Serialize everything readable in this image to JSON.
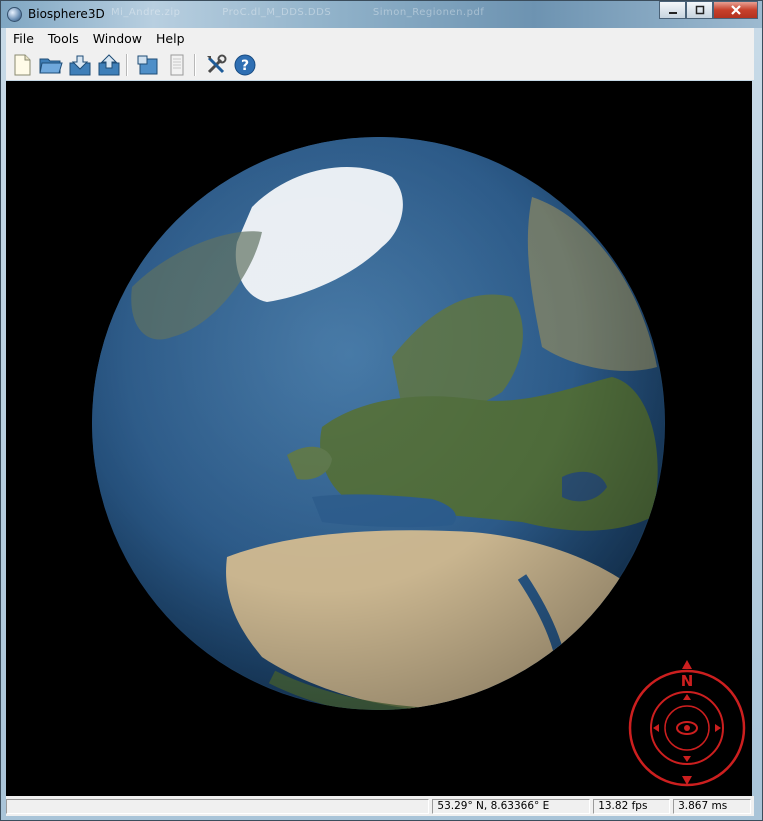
{
  "window": {
    "title": "Biosphere3D",
    "background_tabs": [
      "Mi_Andre.zip",
      "ProC.dl_M_DDS.DDS",
      "Simon_Regionen.pdf"
    ]
  },
  "menu": {
    "items": [
      "File",
      "Tools",
      "Window",
      "Help"
    ]
  },
  "toolbar": {
    "buttons": [
      "new-document-icon",
      "open-folder-icon",
      "import-icon",
      "export-icon",
      "screenshot-icon",
      "page-icon",
      "settings-tools-icon",
      "help-icon"
    ]
  },
  "compass": {
    "north_label": "N",
    "color": "#cc1f1f"
  },
  "status": {
    "message": "",
    "coordinates": "53.29° N, 8.63366° E",
    "fps": "13.82 fps",
    "frame_time": "3.867 ms"
  },
  "colors": {
    "ocean": "#2f5f8c",
    "land_green": "#4e6b3a",
    "desert": "#c9b58f",
    "ice": "#e8edf2",
    "viewport_bg": "#000000"
  }
}
